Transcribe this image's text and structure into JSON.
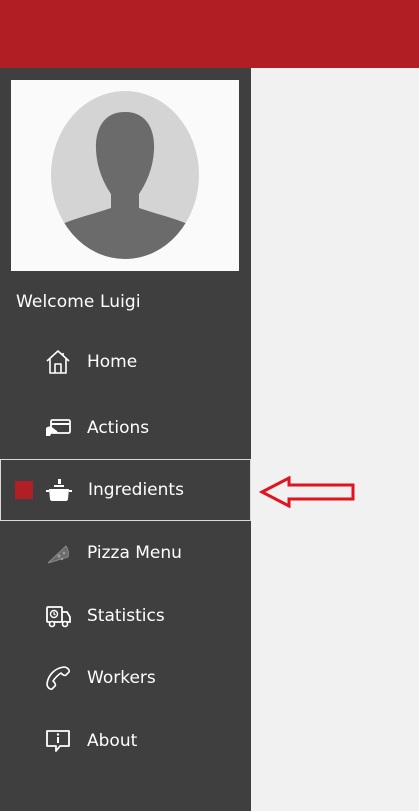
{
  "header": {
    "color": "#b11f24"
  },
  "sidebar": {
    "welcome": "Welcome Luigi",
    "avatar_icon": "user-silhouette-icon",
    "items": [
      {
        "label": "Home",
        "icon": "home-icon",
        "active": false
      },
      {
        "label": "Actions",
        "icon": "credit-card-hand-icon",
        "active": false
      },
      {
        "label": "Ingredients",
        "icon": "cooking-pot-icon",
        "active": true
      },
      {
        "label": "Pizza Menu",
        "icon": "pizza-slice-icon",
        "active": false
      },
      {
        "label": "Statistics",
        "icon": "delivery-truck-icon",
        "active": false
      },
      {
        "label": "Workers",
        "icon": "phone-icon",
        "active": false
      },
      {
        "label": "About",
        "icon": "info-chat-icon",
        "active": false
      }
    ]
  },
  "annotation": {
    "icon": "red-arrow-left-icon",
    "color": "#e0141e"
  }
}
